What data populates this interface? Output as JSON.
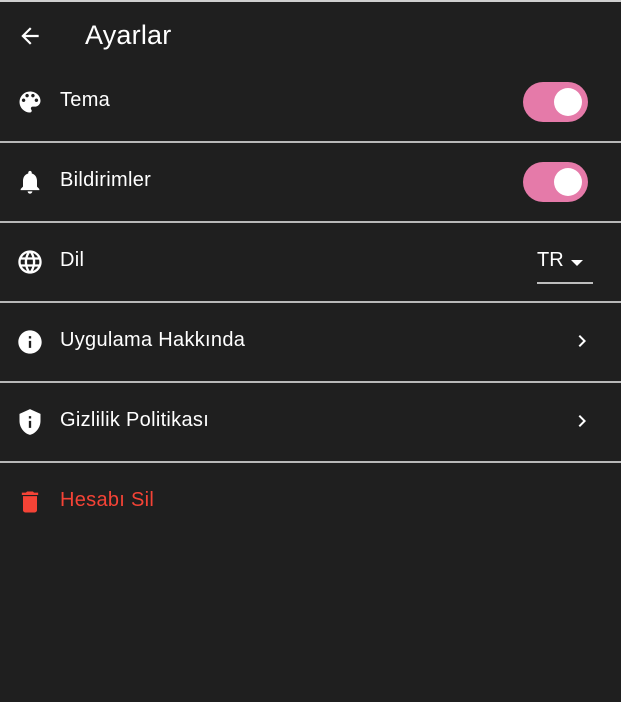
{
  "appbar": {
    "title": "Ayarlar",
    "back_icon": "arrow-back-icon"
  },
  "settings": {
    "theme": {
      "label": "Tema",
      "icon": "palette-icon",
      "enabled": true
    },
    "notifications": {
      "label": "Bildirimler",
      "icon": "bell-icon",
      "enabled": true
    },
    "language": {
      "label": "Dil",
      "icon": "globe-icon",
      "selected": "TR"
    },
    "about": {
      "label": "Uygulama Hakkında",
      "icon": "info-icon"
    },
    "privacy": {
      "label": "Gizlilik Politikası",
      "icon": "shield-info-icon"
    },
    "delete_account": {
      "label": "Hesabı Sil",
      "icon": "trash-icon"
    }
  },
  "colors": {
    "background": "#1f1f1f",
    "toggle_on": "#e57aa9",
    "danger": "#f44336",
    "divider": "#b8b8b8"
  }
}
